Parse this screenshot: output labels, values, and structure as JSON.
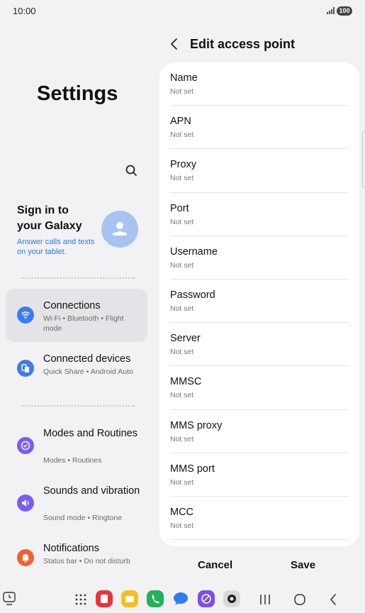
{
  "status": {
    "time": "10:00",
    "battery": "100"
  },
  "left": {
    "title": "Settings",
    "signin": {
      "title": "Sign in to your Galaxy",
      "subtitle": "Answer calls and texts on your tablet."
    },
    "menu": [
      {
        "label": "Connections",
        "sub": "Wi-Fi  •  Bluetooth  •  Flight mode",
        "icon": "wifi-icon",
        "color": "#3d7cf0"
      },
      {
        "label": "Connected devices",
        "sub": "Quick Share  •  Android Auto",
        "icon": "connected-devices-icon",
        "color": "#3d7cf0"
      },
      {
        "label": "Modes and Routines",
        "sub": "Modes  •  Routines",
        "icon": "modes-icon",
        "color": "#7b5cf0"
      },
      {
        "label": "Sounds and vibration",
        "sub": "Sound mode  •  Ringtone",
        "icon": "sound-icon",
        "color": "#7b5cf0"
      },
      {
        "label": "Notifications",
        "sub": "Status bar  •  Do not disturb",
        "icon": "notification-bell-icon",
        "color": "#f0622d"
      }
    ]
  },
  "right": {
    "header": "Edit access point",
    "fields": [
      {
        "label": "Name",
        "value": "Not set"
      },
      {
        "label": "APN",
        "value": "Not set"
      },
      {
        "label": "Proxy",
        "value": "Not set"
      },
      {
        "label": "Port",
        "value": "Not set"
      },
      {
        "label": "Username",
        "value": "Not set"
      },
      {
        "label": "Password",
        "value": "Not set"
      },
      {
        "label": "Server",
        "value": "Not set"
      },
      {
        "label": "MMSC",
        "value": "Not set"
      },
      {
        "label": "MMS proxy",
        "value": "Not set"
      },
      {
        "label": "MMS port",
        "value": "Not set"
      },
      {
        "label": "MCC",
        "value": "Not set"
      }
    ],
    "cancel": "Cancel",
    "save": "Save"
  },
  "navbar": {
    "apps": [
      {
        "icon": "samsung-notes-icon",
        "color": "#e8333a"
      },
      {
        "icon": "my-files-icon",
        "color": "#f6bf1c"
      },
      {
        "icon": "phone-icon",
        "color": "#22b35a"
      },
      {
        "icon": "messages-icon",
        "color": "#2d7cf0"
      },
      {
        "icon": "internet-icon",
        "color": "#7a4df0"
      },
      {
        "icon": "camera-icon",
        "color": "#d8d8dc"
      }
    ]
  }
}
